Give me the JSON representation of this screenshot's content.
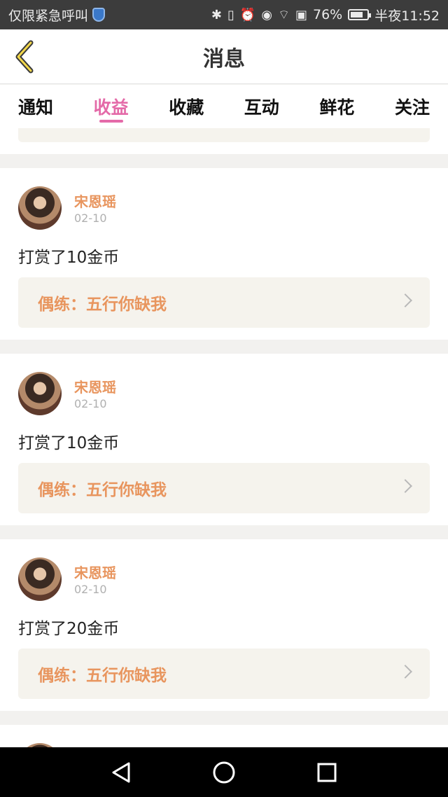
{
  "status_bar": {
    "carrier": "仅限紧急呼叫",
    "battery": "76%",
    "battery_level": 0.76,
    "time": "半夜11:52"
  },
  "header": {
    "title": "消息"
  },
  "tabs": [
    {
      "label": "通知",
      "active": false
    },
    {
      "label": "收益",
      "active": true
    },
    {
      "label": "收藏",
      "active": false
    },
    {
      "label": "互动",
      "active": false
    },
    {
      "label": "鲜花",
      "active": false
    },
    {
      "label": "关注",
      "active": false
    }
  ],
  "cards": [
    {
      "name": "宋恩瑶",
      "date": "02-10",
      "message": "打赏了10金币",
      "link": "偶练：五行你缺我"
    },
    {
      "name": "宋恩瑶",
      "date": "02-10",
      "message": "打赏了10金币",
      "link": "偶练：五行你缺我"
    },
    {
      "name": "宋恩瑶",
      "date": "02-10",
      "message": "打赏了20金币",
      "link": "偶练：五行你缺我"
    }
  ],
  "colors": {
    "accent_pink": "#e46aa8",
    "accent_orange": "#e8955e"
  }
}
